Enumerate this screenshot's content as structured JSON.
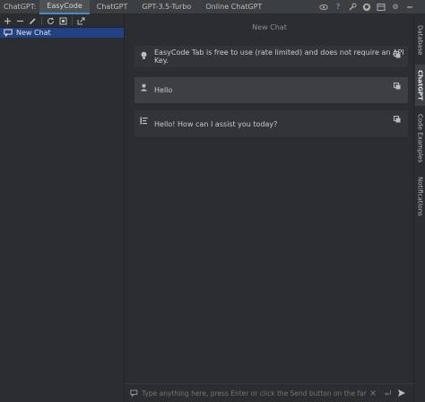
{
  "top_bar": {
    "prefix": "ChatGPT:",
    "tabs": [
      {
        "label": "EasyCode",
        "active": true
      },
      {
        "label": "ChatGPT",
        "active": false
      },
      {
        "label": "GPT-3.5-Turbo",
        "active": false
      },
      {
        "label": "Online ChatGPT",
        "active": false
      }
    ],
    "icons": [
      "eye-icon",
      "help-icon",
      "wrench-icon",
      "github-icon",
      "layout-icon",
      "settings-icon",
      "minimize-icon"
    ]
  },
  "left_panel": {
    "toolbar_icons": [
      "add-icon",
      "remove-icon",
      "edit-icon",
      "refresh-icon",
      "model-icon",
      "export-icon"
    ],
    "chats": [
      {
        "label": "New Chat",
        "selected": true
      }
    ]
  },
  "main": {
    "title": "New Chat",
    "messages": [
      {
        "role": "system",
        "icon": "lightbulb-icon",
        "text": "EasyCode Tab is free to use (rate limited) and does not require an API Key."
      },
      {
        "role": "user",
        "icon": "person-icon",
        "text": "Hello"
      },
      {
        "role": "assistant",
        "icon": "bot-icon",
        "text": "Hello! How can I assist you today?"
      }
    ],
    "input": {
      "placeholder": "Type anything here, press Enter or click the Send button on the far right."
    }
  },
  "right_strip": {
    "tabs": [
      {
        "label": "Database",
        "active": false
      },
      {
        "label": "ChatGPT",
        "active": true
      },
      {
        "label": "Code Examples",
        "active": false
      },
      {
        "label": "Notifications",
        "active": false
      }
    ]
  },
  "colors": {
    "background": "#2b2d30",
    "tab_active": "#4e5254",
    "selection": "#214283",
    "message_bg": "#323437",
    "accent": "#4a88c7"
  }
}
